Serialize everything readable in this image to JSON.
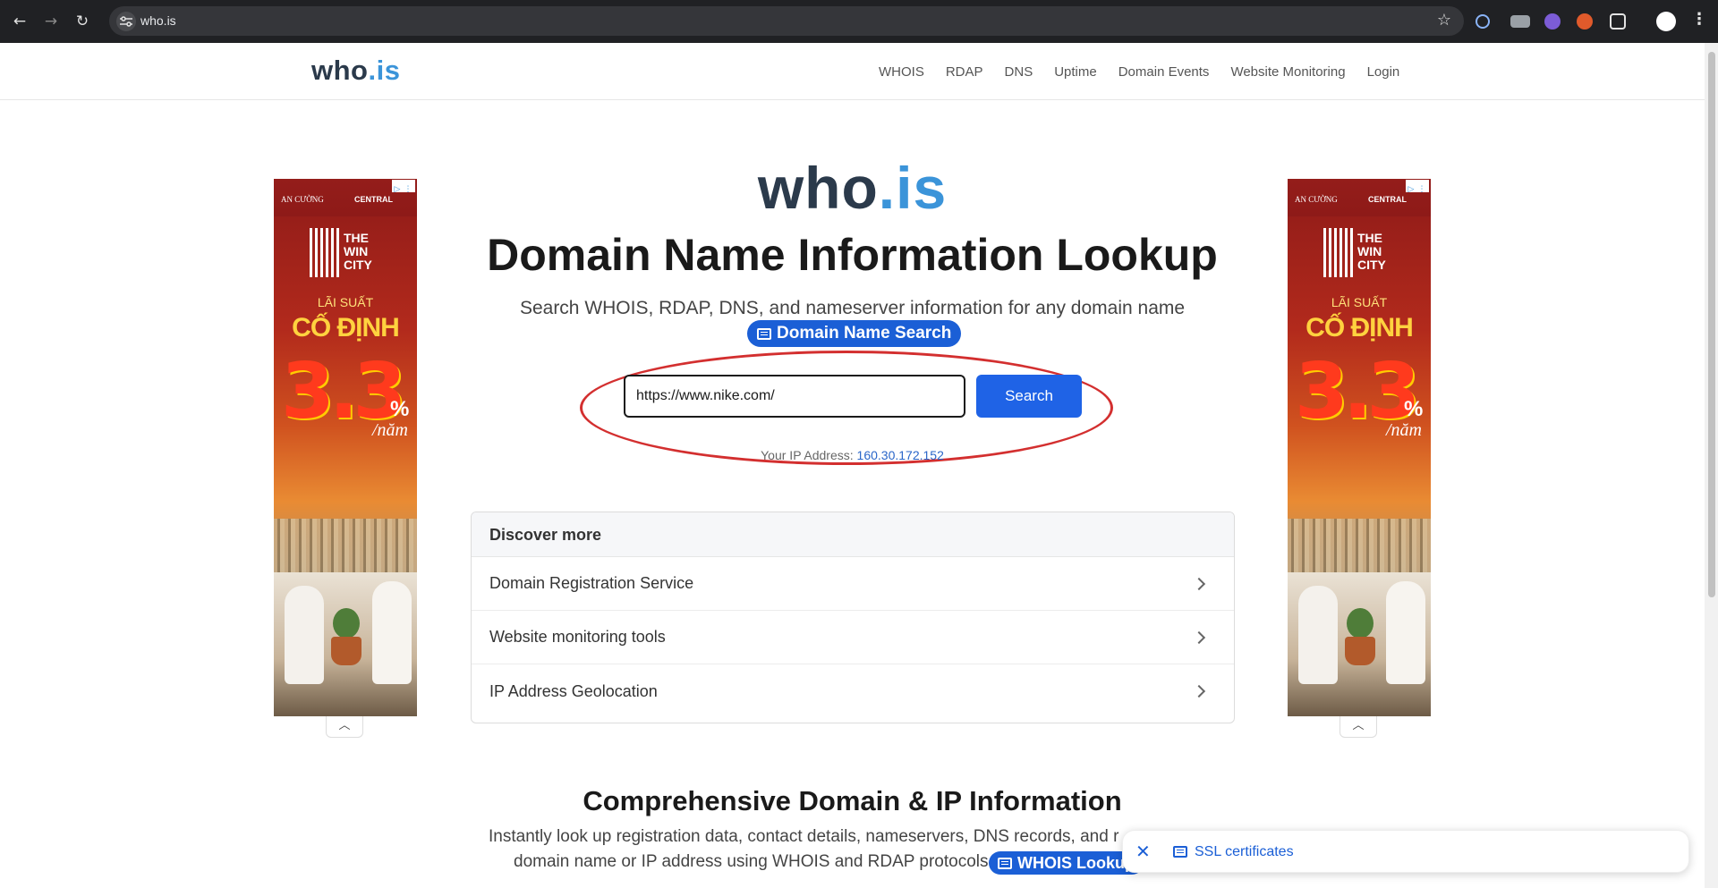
{
  "browser": {
    "url": "who.is",
    "back_icon": "arrow-left-icon",
    "forward_icon": "arrow-right-icon",
    "reload_icon": "reload-icon"
  },
  "site": {
    "brand_who": "who",
    "brand_is": ".is",
    "nav": [
      "WHOIS",
      "RDAP",
      "DNS",
      "Uptime",
      "Domain Events",
      "Website Monitoring",
      "Login"
    ]
  },
  "hero": {
    "logo_who": "who",
    "logo_is": ".is",
    "title": "Domain Name Information Lookup",
    "subtitle": "Search WHOIS, RDAP, DNS, and nameserver information for any domain name",
    "pill_label": "Domain Name Search",
    "search_value": "https://www.nike.com/",
    "search_button": "Search",
    "ip_label": "Your IP Address:",
    "ip_value": "160.30.172.152"
  },
  "ads": {
    "brand1": "AN CƯỜNG",
    "brand2": "CENTRAL",
    "project": "THE WIN CITY",
    "line1": "LÃI SUẤT",
    "line2": "CỐ ĐỊNH",
    "rate": "3.3",
    "percent": "%",
    "per": "/năm"
  },
  "discover": {
    "heading": "Discover more",
    "items": [
      "Domain Registration Service",
      "Website monitoring tools",
      "IP Address Geolocation"
    ]
  },
  "section": {
    "title": "Comprehensive Domain & IP Information",
    "p1": "Instantly look up registration data, contact details, nameservers, DNS records, and r",
    "p2": "domain name or IP address using WHOIS and RDAP protocols.",
    "pill_label": "WHOIS Lookup"
  },
  "toast": {
    "label": "SSL certificates"
  },
  "colors": {
    "brand_dark": "#2b3a4b",
    "brand_blue": "#3b94d9",
    "primary_button": "#1f63e6",
    "pill": "#1b5fd6",
    "annotation": "#d32f2f"
  }
}
